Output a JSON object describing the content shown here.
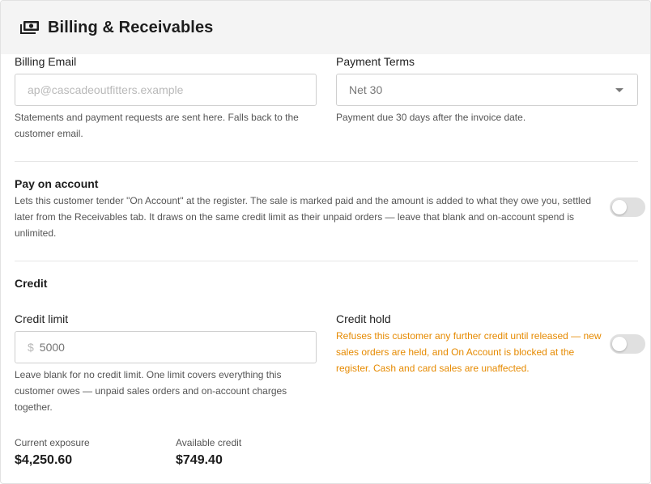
{
  "header": {
    "title": "Billing & Receivables",
    "icon": "cash-icon"
  },
  "billing_email": {
    "label": "Billing Email",
    "value": "",
    "placeholder": "ap@cascadeoutfitters.example",
    "help": "Statements and payment requests are sent here. Falls back to the customer email."
  },
  "payment_terms": {
    "label": "Payment Terms",
    "selected": "Net 30",
    "help": "Payment due 30 days after the invoice date."
  },
  "pay_on_account": {
    "label": "Pay on account",
    "description": "Lets this customer tender \"On Account\" at the register. The sale is marked paid and the amount is added to what they owe you, settled later from the Receivables tab. It draws on the same credit limit as their unpaid orders — leave that blank and on-account spend is unlimited.",
    "enabled": false
  },
  "credit": {
    "section_title": "Credit",
    "limit": {
      "label": "Credit limit",
      "currency_symbol": "$",
      "value": "",
      "placeholder": "5000",
      "help": "Leave blank for no credit limit. One limit covers everything this customer owes — unpaid sales orders and on-account charges together."
    },
    "hold": {
      "label": "Credit hold",
      "description": "Refuses this customer any further credit until released — new sales orders are held, and On Account is blocked at the register. Cash and card sales are unaffected.",
      "enabled": false
    },
    "current_exposure": {
      "label": "Current exposure",
      "value": "$4,250.60"
    },
    "available_credit": {
      "label": "Available credit",
      "value": "$749.40"
    }
  },
  "colors": {
    "header_bg": "#f4f4f4",
    "warning_text": "#e68a00",
    "toggle_off": "#e0e0e0"
  }
}
